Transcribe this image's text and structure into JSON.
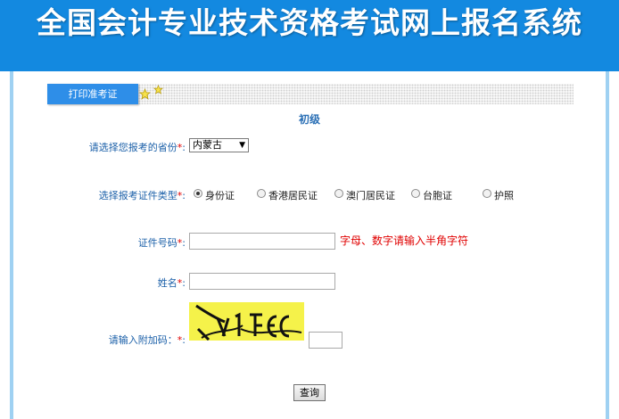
{
  "header": {
    "title": "全国会计专业技术资格考试网上报名系统"
  },
  "tabs": {
    "active_label": "打印准考证"
  },
  "level": "初级",
  "form": {
    "province_label": "请选择您报考的省份",
    "province_value": "内蒙古",
    "id_type_label": "选择报考证件类型",
    "id_types": [
      "身份证",
      "香港居民证",
      "澳门居民证",
      "台胞证",
      "护照"
    ],
    "id_type_selected": "身份证",
    "id_number_label": "证件号码",
    "id_number_hint": "字母、数字请输入半角字符",
    "name_label": "姓名",
    "captcha_label": "请输入附加码：",
    "required_mark": "*",
    "colon": ":",
    "submit_label": "查询"
  },
  "colors": {
    "header": "#1389e0",
    "tab": "#2e8ee8",
    "label": "#1a5fa8",
    "required": "#e00000",
    "captcha_bg": "#f5f24a"
  }
}
